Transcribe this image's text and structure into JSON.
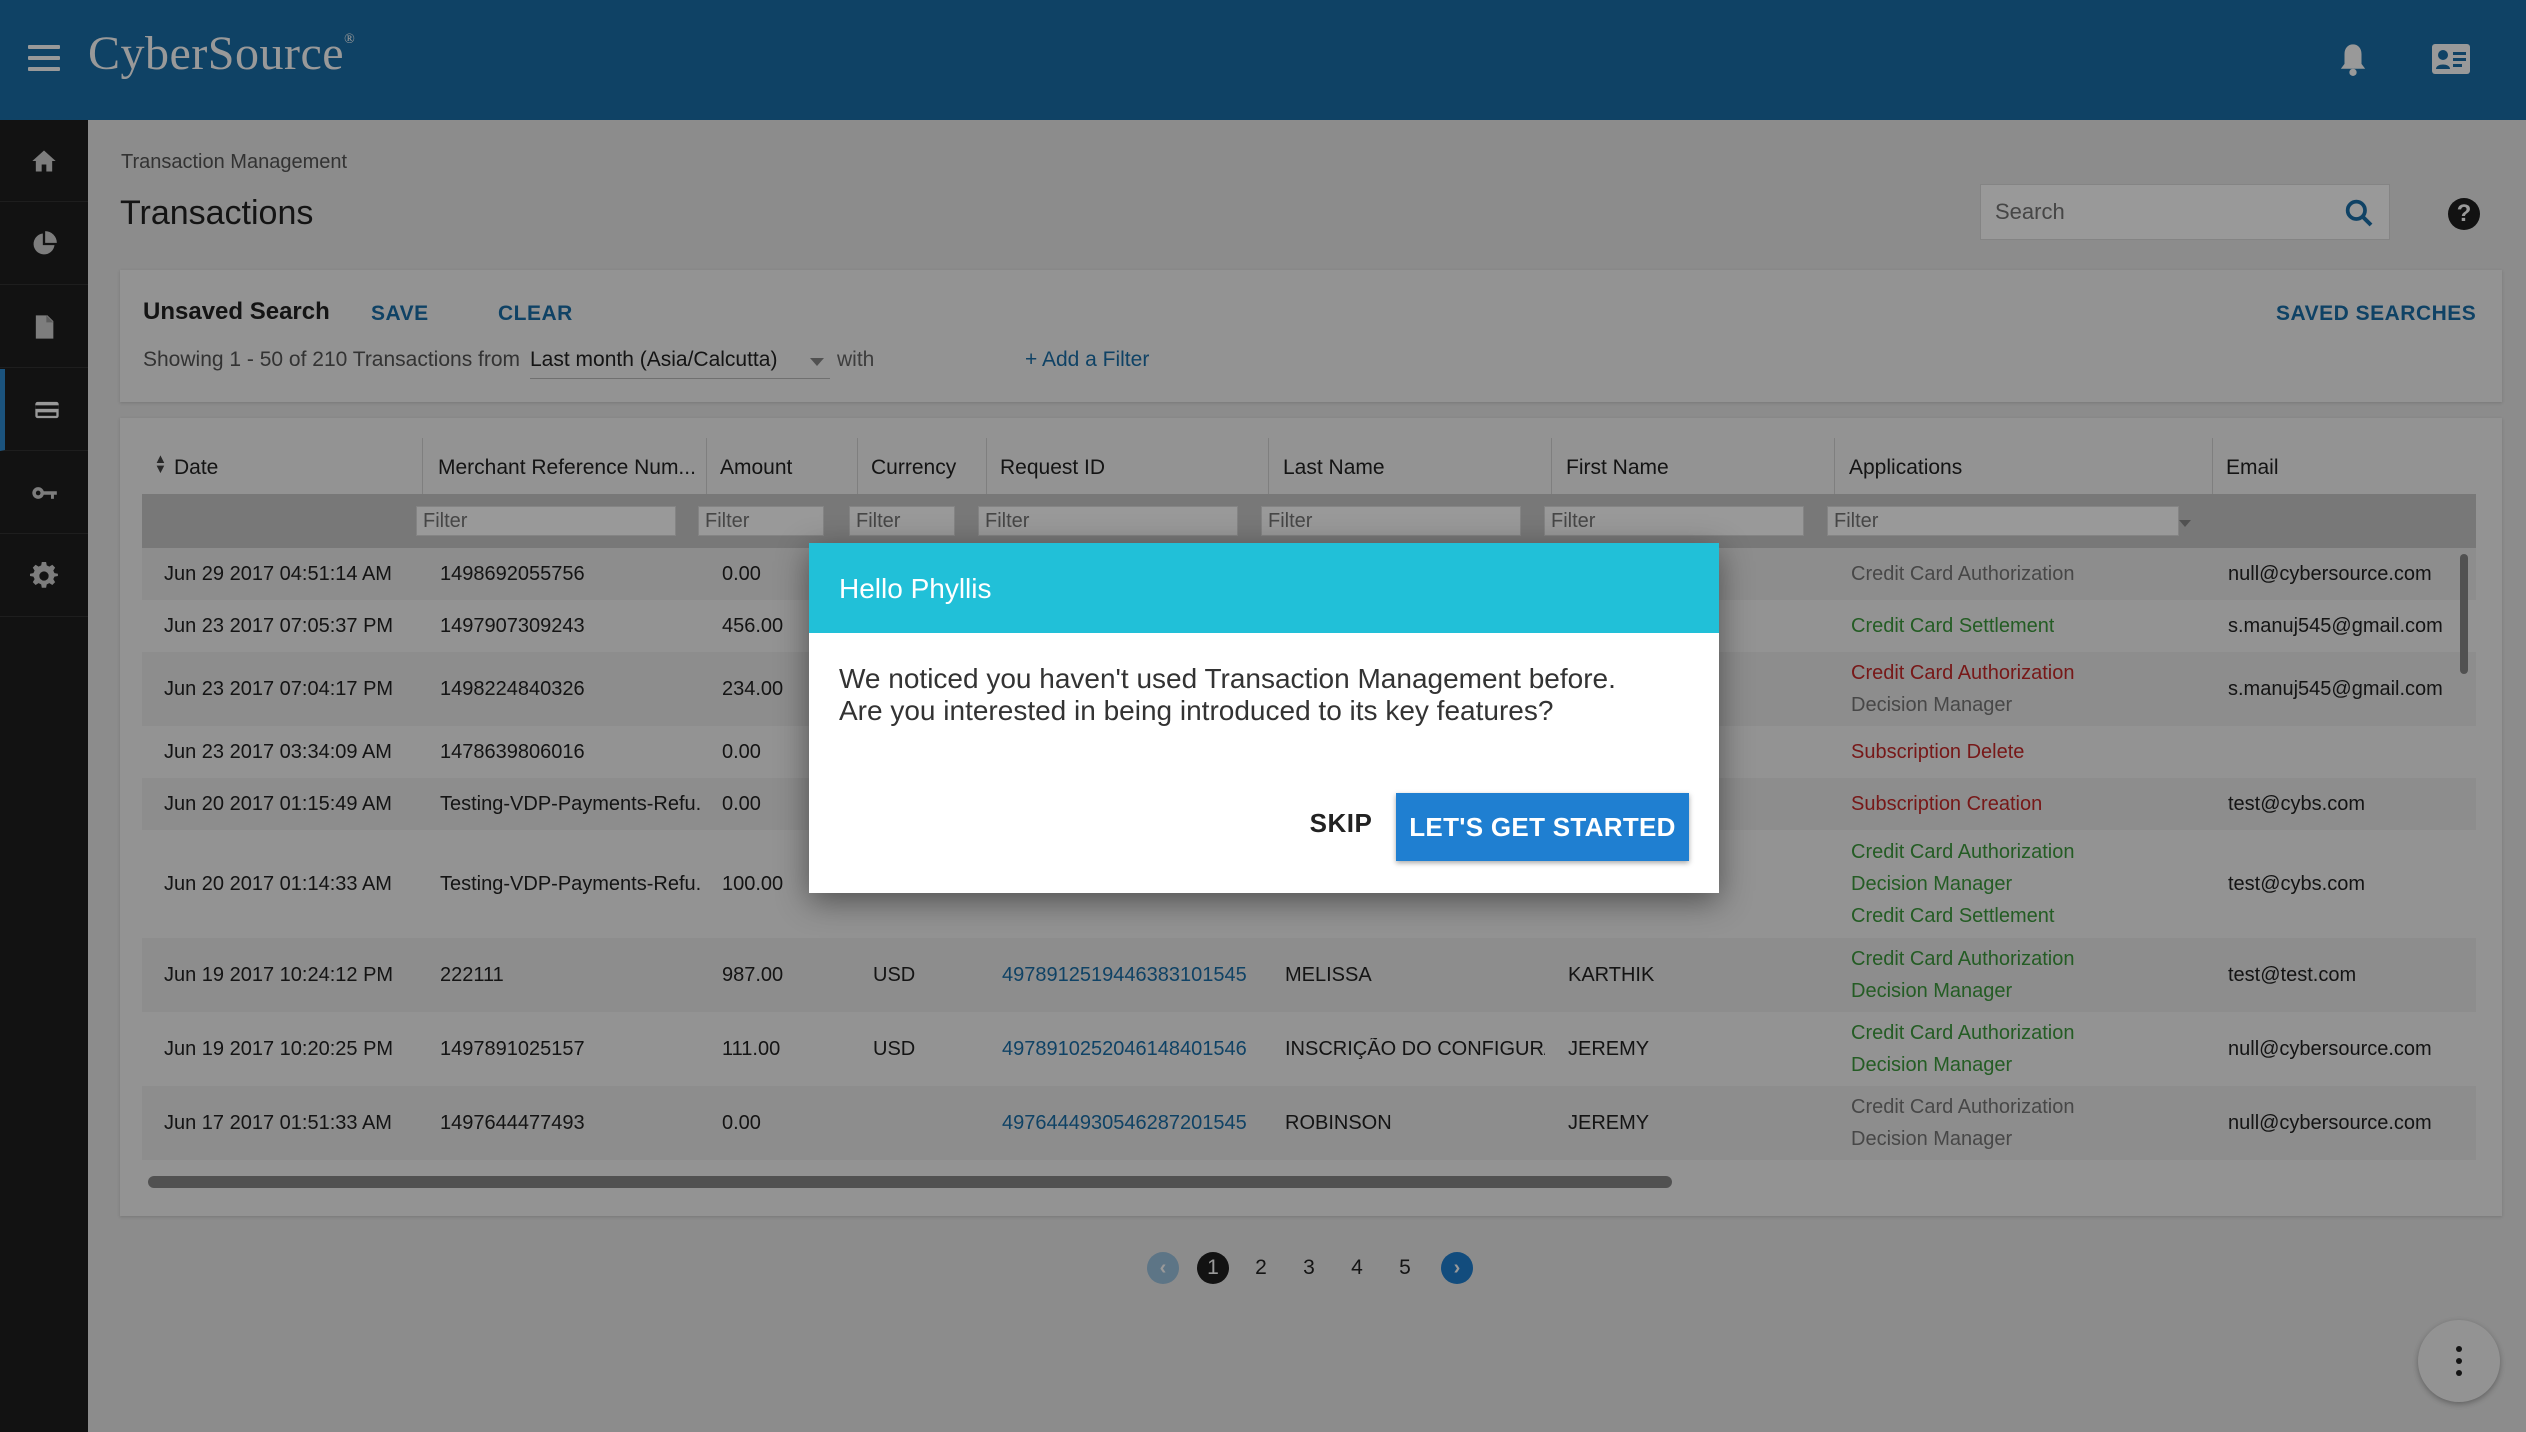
{
  "header": {
    "logo": "CyberSource",
    "logo_mark": "®"
  },
  "sidenav": [
    "home-icon",
    "pie-chart-icon",
    "document-icon",
    "card-icon",
    "key-icon",
    "gear-icon"
  ],
  "breadcrumb": "Transaction Management",
  "page_title": "Transactions",
  "search": {
    "placeholder": "Search"
  },
  "help": "?",
  "search_panel": {
    "title": "Unsaved Search",
    "save": "SAVE",
    "clear": "CLEAR",
    "saved_searches": "SAVED SEARCHES",
    "showing": "Showing 1 - 50 of 210 Transactions from",
    "range": "Last month (Asia/Calcutta)",
    "with": "with",
    "add_filter": "+ Add a Filter"
  },
  "table": {
    "columns": [
      "Date",
      "Merchant Reference Num...",
      "Amount",
      "Currency",
      "Request ID",
      "Last Name",
      "First Name",
      "Applications",
      "Email"
    ],
    "filter_placeholder": "Filter",
    "rows": [
      {
        "date": "Jun 29 2017 04:51:14 AM",
        "ref": "1498692055756",
        "amount": "0.00",
        "currency": "",
        "request_id": "",
        "last": "",
        "first": "",
        "apps": [
          {
            "t": "Credit Card Authorization",
            "c": "grey"
          }
        ],
        "email": "null@cybersource.com"
      },
      {
        "date": "Jun 23 2017 07:05:37 PM",
        "ref": "1497907309243",
        "amount": "456.00",
        "currency": "",
        "request_id": "",
        "last": "",
        "first": "",
        "apps": [
          {
            "t": "Credit Card Settlement",
            "c": "green"
          }
        ],
        "email": "s.manuj545@gmail.com"
      },
      {
        "date": "Jun 23 2017 07:04:17 PM",
        "ref": "1498224840326",
        "amount": "234.00",
        "currency": "",
        "request_id": "",
        "last": "",
        "first": "",
        "apps": [
          {
            "t": "Credit Card Authorization",
            "c": "red"
          },
          {
            "t": "Decision Manager",
            "c": "grey"
          }
        ],
        "email": "s.manuj545@gmail.com"
      },
      {
        "date": "Jun 23 2017 03:34:09 AM",
        "ref": "1478639806016",
        "amount": "0.00",
        "currency": "",
        "request_id": "",
        "last": "",
        "first": "",
        "apps": [
          {
            "t": "Subscription Delete",
            "c": "red"
          }
        ],
        "email": ""
      },
      {
        "date": "Jun 20 2017 01:15:49 AM",
        "ref": "Testing-VDP-Payments-Refu...",
        "amount": "0.00",
        "currency": "",
        "request_id": "",
        "last": "",
        "first": "",
        "apps": [
          {
            "t": "Subscription Creation",
            "c": "red"
          }
        ],
        "email": "test@cybs.com"
      },
      {
        "date": "Jun 20 2017 01:14:33 AM",
        "ref": "Testing-VDP-Payments-Refu...",
        "amount": "100.00",
        "currency": "",
        "request_id": "",
        "last": "",
        "first": "",
        "apps": [
          {
            "t": "Credit Card Authorization",
            "c": "green"
          },
          {
            "t": "Decision Manager",
            "c": "green"
          },
          {
            "t": "Credit Card Settlement",
            "c": "green"
          }
        ],
        "email": "test@cybs.com"
      },
      {
        "date": "Jun 19 2017 10:24:12 PM",
        "ref": "222111",
        "amount": "987.00",
        "currency": "USD",
        "request_id": "4978912519446383101545",
        "last": "MELISSA",
        "first": "KARTHIK",
        "apps": [
          {
            "t": "Credit Card Authorization",
            "c": "green"
          },
          {
            "t": "Decision Manager",
            "c": "green"
          }
        ],
        "email": "test@test.com"
      },
      {
        "date": "Jun 19 2017 10:20:25 PM",
        "ref": "1497891025157",
        "amount": "111.00",
        "currency": "USD",
        "request_id": "4978910252046148401546",
        "last": "INSCRIÇÃO DO CONFIGURA...",
        "first": "JEREMY",
        "apps": [
          {
            "t": "Credit Card Authorization",
            "c": "green"
          },
          {
            "t": "Decision Manager",
            "c": "green"
          }
        ],
        "email": "null@cybersource.com"
      },
      {
        "date": "Jun 17 2017 01:51:33 AM",
        "ref": "1497644477493",
        "amount": "0.00",
        "currency": "",
        "request_id": "4976444930546287201545",
        "last": "ROBINSON",
        "first": "JEREMY",
        "apps": [
          {
            "t": "Credit Card Authorization",
            "c": "grey"
          },
          {
            "t": "Decision Manager",
            "c": "grey"
          }
        ],
        "email": "null@cybersource.com"
      }
    ]
  },
  "pagination": {
    "prev": "‹",
    "pages": [
      "1",
      "2",
      "3",
      "4",
      "5"
    ],
    "current": "1",
    "next": "›"
  },
  "modal": {
    "title": "Hello Phyllis",
    "message": "We noticed you haven't used Transaction Management before. Are you interested in being introduced to its key features?",
    "skip": "SKIP",
    "start": "LET'S GET STARTED"
  },
  "colors": {
    "header": "#1a6fa8",
    "accent": "#21c0d8",
    "primary_button": "#1f7fd1",
    "nav": "#1e1e1e"
  }
}
